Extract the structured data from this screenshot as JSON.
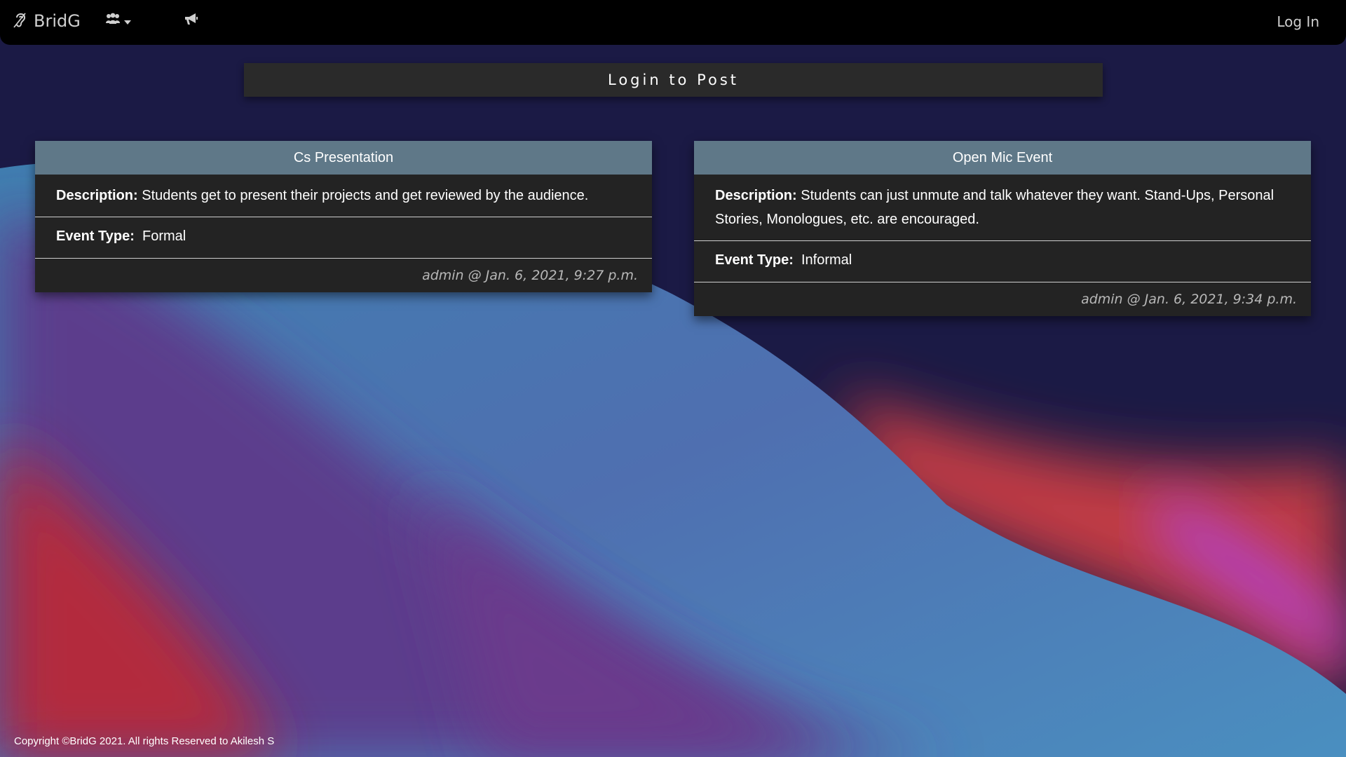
{
  "navbar": {
    "brand_name": "BridG",
    "brand_icon": "ear-icon",
    "groups_icon": "users-icon",
    "announce_icon": "bullhorn-icon",
    "login_label": "Log In"
  },
  "main": {
    "post_button_label": "Login to Post",
    "events": [
      {
        "title": "Cs Presentation",
        "description_label": "Description:",
        "description": "Students get to present their projects and get reviewed by the audience.",
        "event_type_label": "Event Type:",
        "event_type": "Formal",
        "meta": "admin @ Jan. 6, 2021, 9:27 p.m."
      },
      {
        "title": "Open Mic Event",
        "description_label": "Description:",
        "description": "Students can just unmute and talk whatever they want. Stand-Ups, Personal Stories, Monologues, etc. are encouraged.",
        "event_type_label": "Event Type:",
        "event_type": "Informal",
        "meta": "admin @ Jan. 6, 2021, 9:34 p.m."
      }
    ]
  },
  "footer": {
    "copyright": "Copyright ©BridG 2021. All rights Reserved to Akilesh S"
  },
  "colors": {
    "navbar": "#000000",
    "card_header": "#5f7888",
    "card_body": "#232323",
    "post_button": "#2a2a2a"
  }
}
